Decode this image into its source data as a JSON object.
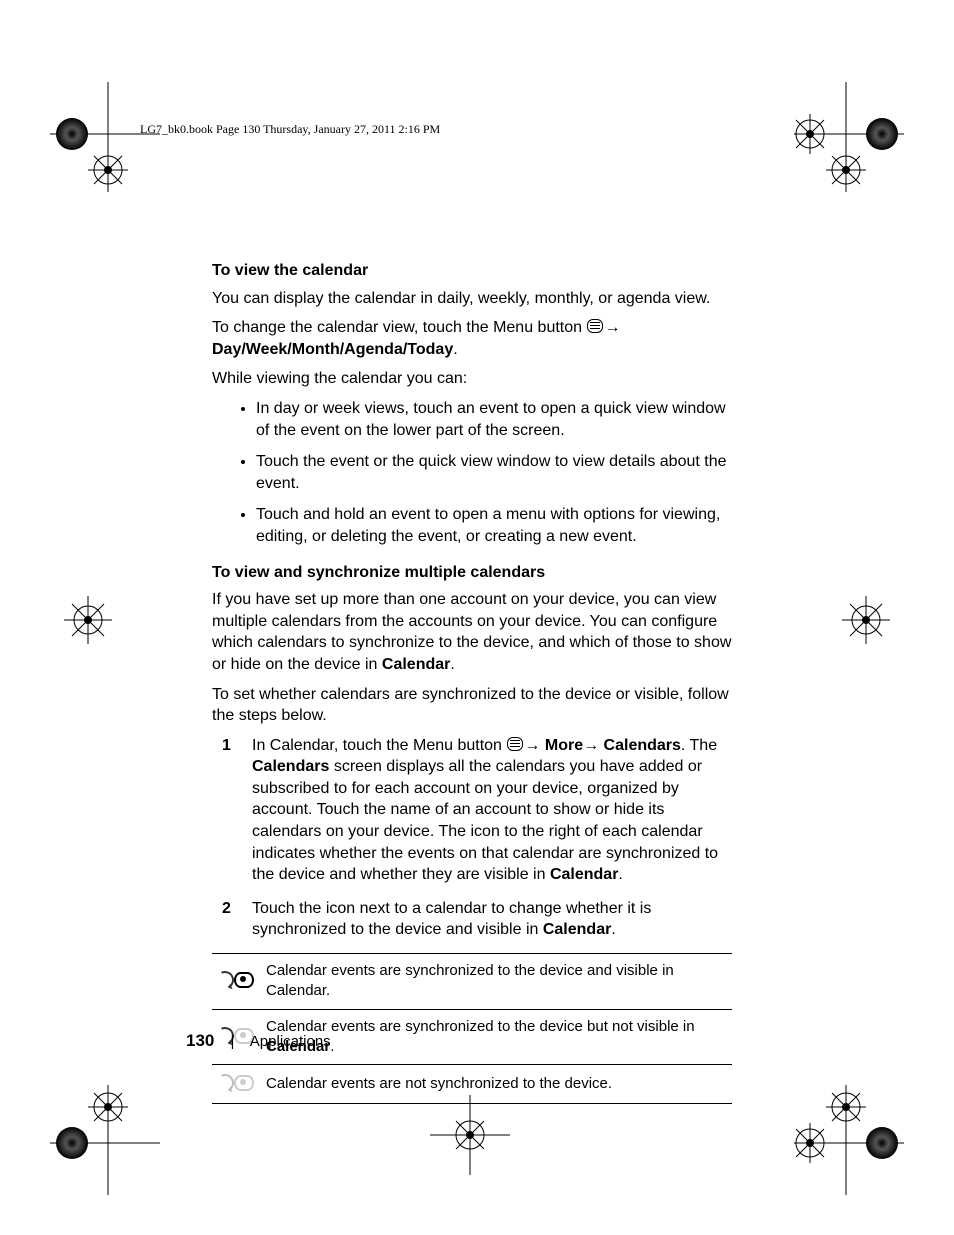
{
  "header_line": "LG7_bk0.book  Page 130  Thursday, January 27, 2011  2:16 PM",
  "section1": {
    "heading": "To view the calendar",
    "p1": "You can display the calendar in daily, weekly, monthly, or agenda view.",
    "p2a": "To change the calendar view, touch the Menu button ",
    "p2_bold": "Day/Week/Month/Agenda/Today",
    "p3": "While viewing the calendar you can:",
    "bullets": [
      "In day or week views, touch an event to open a quick view window of the event on the lower part of the screen.",
      "Touch the event or the quick view window to view details about the event.",
      "Touch and hold an event to open a menu with options for viewing, editing, or deleting the event, or creating a new event."
    ]
  },
  "section2": {
    "heading": "To view and synchronize multiple calendars",
    "p1a": "If you have set up more than one account on your device, you can view multiple calendars from the accounts on your device. You can configure which calendars to synchronize to the device, and which of those to show or hide on the device in ",
    "p1_bold": "Calendar",
    "p2": "To set whether calendars are synchronized to the device or visible, follow the steps below.",
    "steps": [
      {
        "num": "1",
        "a": "In Calendar, touch the Menu button ",
        "more": "More",
        "cal": "Calendars",
        "b": ". The ",
        "cal2": "Calendars",
        "c": " screen displays all the calendars you have added or subscribed to for each account on your device, organized by account. Touch the name of an account to show or hide its calendars on your device. The icon to the right of each calendar indicates whether the events on that calendar are synchronized to the device and whether they are visible in ",
        "cal3": "Calendar",
        "d": "."
      },
      {
        "num": "2",
        "a": "Touch the icon next to a calendar to change whether it is synchronized to the device and visible in ",
        "cal": "Calendar",
        "b": "."
      }
    ],
    "legend": [
      {
        "iconName": "sync-visible-icon",
        "text_a": "Calendar events are synchronized to the device and visible in Calendar."
      },
      {
        "iconName": "sync-notvisible-icon",
        "text_a": "Calendar events are synchronized to the device but not visible in ",
        "bold": "Calendar",
        "text_b": "."
      },
      {
        "iconName": "not-synced-icon",
        "text_a": "Calendar events are not synchronized to the device."
      }
    ]
  },
  "footer": {
    "page_number": "130",
    "section_name": "Applications"
  }
}
